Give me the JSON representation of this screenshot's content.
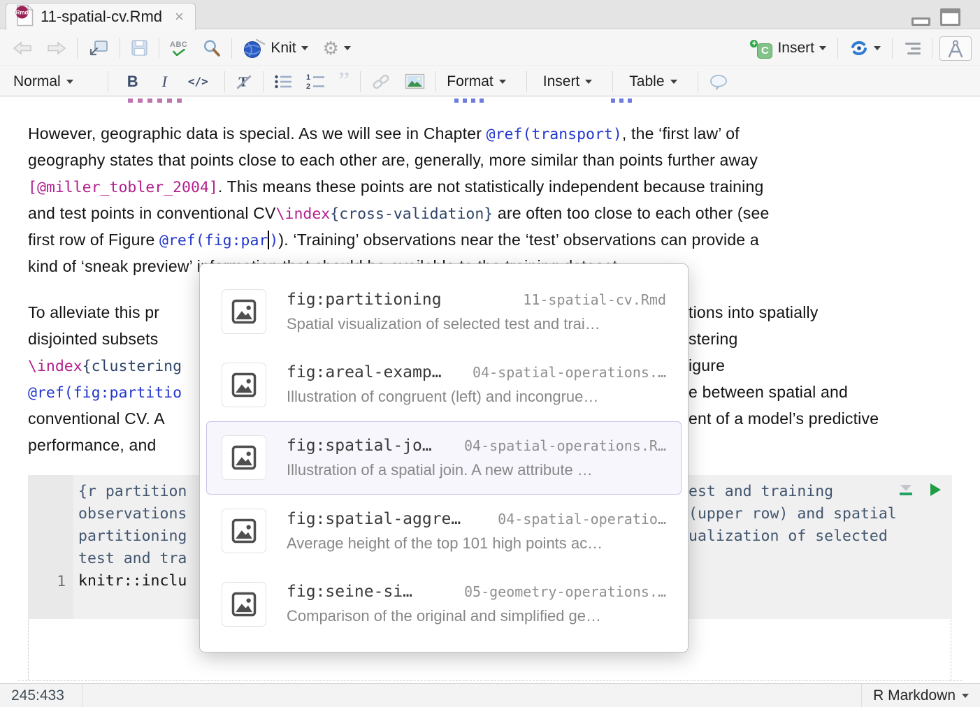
{
  "tab": {
    "title": "11-spatial-cv.Rmd",
    "close": "×",
    "file_badge": "Rmd"
  },
  "toolbar": {
    "knit": "Knit",
    "insert_chunk": "Insert",
    "spellcheck": "ABC",
    "chunk_icon_letter": "C",
    "chunk_icon_plus": "+"
  },
  "format_bar": {
    "style": "Normal",
    "bold": "B",
    "italic": "I",
    "code": "</>",
    "quote": "”",
    "ol1": "1",
    "ol2": "2",
    "format": "Format",
    "insert": "Insert",
    "table": "Table"
  },
  "document": {
    "para1": {
      "l1a": "However, geographic data is special. As we will see in Chapter ",
      "l1b": "@ref(transport)",
      "l1c": ", the ‘first law’ of",
      "l2": "geography states that points close to each other are, generally, more similar than points further away",
      "l3a": "[@miller_tobler_2004]",
      "l3b": ". This means these points are not statistically independent because training",
      "l4a": "and test points in conventional CV",
      "l4b": "\\index",
      "l4c": "{cross-validation}",
      "l4d": " are often too close to each other (see",
      "l5a": "first row of Figure ",
      "l5b": "@ref(fig:par",
      "l5c": ")",
      "l5d": "). ‘Training’ observations near the ‘test’ observations can provide a",
      "l6": "kind of ‘sneak preview’ information that should be available to the training dataset."
    },
    "para2": {
      "l1a": "To alleviate this pr",
      "l1b": "tions into spatially",
      "l2a": "disjointed subsets",
      "l2b": "stering",
      "l3a": "\\index",
      "l3b": "{clustering",
      "l3c": "igure",
      "l4a": "@ref(fig:partitio",
      "l4b": "e between spatial and",
      "l5a": "conventional CV. A",
      "l5b": "ent of a model’s predictive",
      "l6a": "performance, and"
    },
    "chunk": {
      "h1a": "{r partition",
      "h1b": "est and training",
      "h2a": "observations",
      "h2b": "(upper row) and spatial",
      "h3a": "partitioning",
      "h3b": "ualization of selected",
      "h4a": "test and tra",
      "lineno": "1",
      "c1": "knitr::inclu"
    }
  },
  "popup": {
    "items": [
      {
        "title": "fig:partitioning",
        "file": "11-spatial-cv.Rmd",
        "desc": "Spatial visualization of selected test and trai…"
      },
      {
        "title": "fig:areal-examp…",
        "file": "04-spatial-operations.…",
        "desc": "Illustration of congruent (left) and incongrue…"
      },
      {
        "title": "fig:spatial-jo…",
        "file": "04-spatial-operations.R…",
        "desc": "Illustration of a spatial join. A new attribute …"
      },
      {
        "title": "fig:spatial-aggre…",
        "file": "04-spatial-operatio…",
        "desc": "Average height of the top 101 high points ac…"
      },
      {
        "title": "fig:seine-si…",
        "file": "05-geometry-operations.…",
        "desc": "Comparison of the original and simplified ge…"
      }
    ]
  },
  "status": {
    "position": "245:433",
    "mode": "R Markdown"
  }
}
